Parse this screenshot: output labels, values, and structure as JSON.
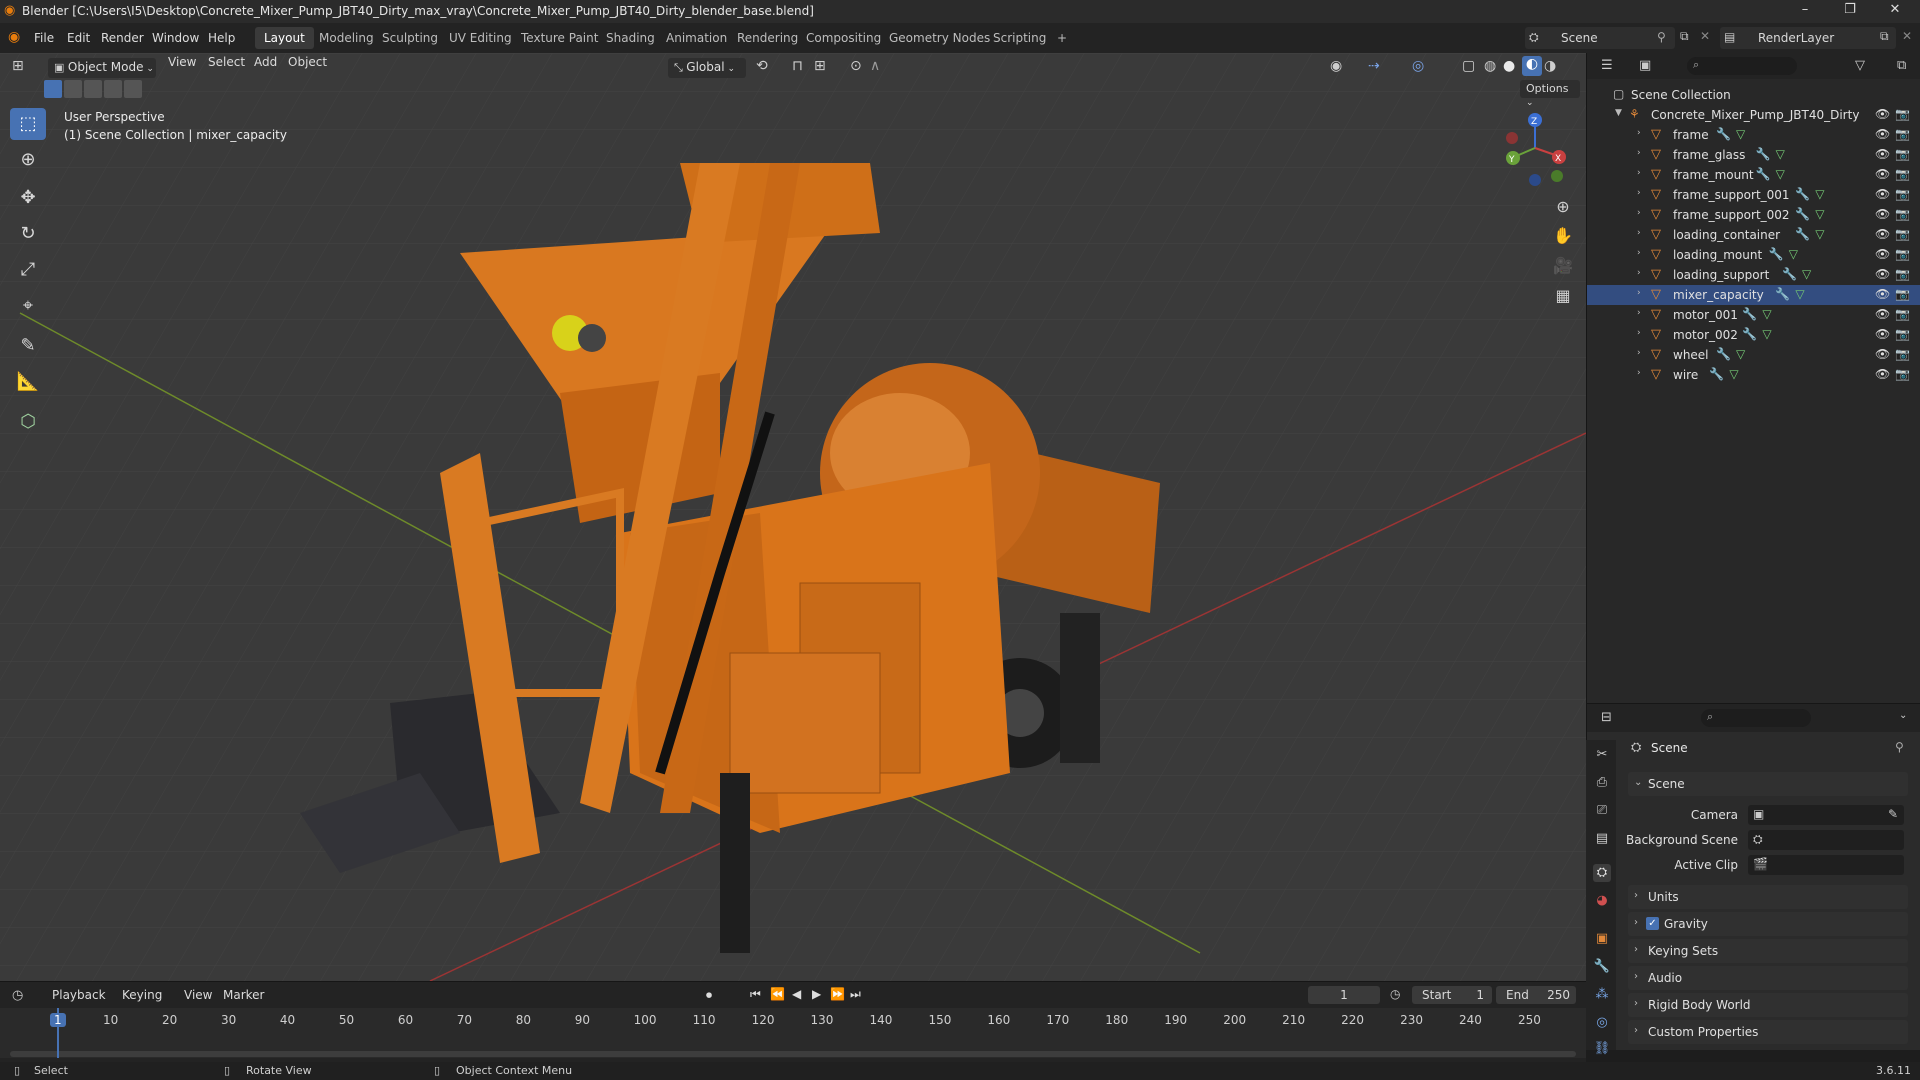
{
  "window": {
    "title": "Blender [C:\\Users\\I5\\Desktop\\Concrete_Mixer_Pump_JBT40_Dirty_max_vray\\Concrete_Mixer_Pump_JBT40_Dirty_blender_base.blend]",
    "minimize": "–",
    "maximize": "❐",
    "close": "✕"
  },
  "menu": {
    "items": [
      "File",
      "Edit",
      "Render",
      "Window",
      "Help"
    ]
  },
  "workspaces": {
    "active": "Layout",
    "tabs": [
      "Layout",
      "Modeling",
      "Sculpting",
      "UV Editing",
      "Texture Paint",
      "Shading",
      "Animation",
      "Rendering",
      "Compositing",
      "Geometry Nodes",
      "Scripting"
    ],
    "add": "+"
  },
  "scene_selector": {
    "scene": "Scene",
    "layer": "RenderLayer"
  },
  "viewport_header": {
    "mode": "Object Mode",
    "menus": [
      "View",
      "Select",
      "Add",
      "Object"
    ],
    "orientation": "Global",
    "options": "Options"
  },
  "viewport": {
    "perspective": "User Perspective",
    "context": "(1) Scene Collection | mixer_capacity",
    "gizmo": {
      "x": "X",
      "y": "Y",
      "z": "Z"
    }
  },
  "tools": [
    "select-box",
    "cursor",
    "move",
    "rotate",
    "scale",
    "transform",
    "annotate",
    "measure",
    "add-cube"
  ],
  "outliner": {
    "root": "Scene Collection",
    "collection": "Concrete_Mixer_Pump_JBT40_Dirty",
    "objects": [
      "frame",
      "frame_glass",
      "frame_mount",
      "frame_support_001",
      "frame_support_002",
      "loading_container",
      "loading_mount",
      "loading_support",
      "mixer_capacity",
      "motor_001",
      "motor_002",
      "wheel",
      "wire"
    ],
    "active": "mixer_capacity"
  },
  "properties": {
    "header": "Scene",
    "panel_scene": "Scene",
    "fields": {
      "camera": "Camera",
      "background": "Background Scene",
      "clip": "Active Clip"
    },
    "panels": [
      "Units",
      "Gravity",
      "Keying Sets",
      "Audio",
      "Rigid Body World",
      "Custom Properties"
    ],
    "gravity_checked": true
  },
  "timeline": {
    "menus": [
      "Playback",
      "Keying",
      "View",
      "Marker"
    ],
    "current_frame": "1",
    "start_label": "Start",
    "start": "1",
    "end_label": "End",
    "end": "250",
    "ticks": [
      "1",
      "10",
      "20",
      "30",
      "40",
      "50",
      "60",
      "70",
      "80",
      "90",
      "100",
      "110",
      "120",
      "130",
      "140",
      "150",
      "160",
      "170",
      "180",
      "190",
      "200",
      "210",
      "220",
      "230",
      "240",
      "250"
    ]
  },
  "status": {
    "select": "Select",
    "rotate": "Rotate View",
    "context": "Object Context Menu",
    "version": "3.6.11"
  },
  "colors": {
    "accent": "#4772b3",
    "mesh": "#e0883a",
    "orange_model": "#d9741a"
  }
}
